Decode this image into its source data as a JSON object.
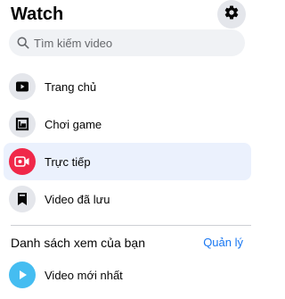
{
  "header": {
    "title": "Watch",
    "settings_icon": "gear-icon"
  },
  "search": {
    "placeholder": "Tìm kiếm video",
    "value": ""
  },
  "menu": {
    "items": [
      {
        "label": "Trang chủ",
        "icon": "play-icon",
        "active": false
      },
      {
        "label": "Chơi game",
        "icon": "gaming-icon",
        "active": false
      },
      {
        "label": "Trực tiếp",
        "icon": "live-camera-icon",
        "active": true
      },
      {
        "label": "Video đã lưu",
        "icon": "bookmark-icon",
        "active": false
      }
    ]
  },
  "watchlist": {
    "title": "Danh sách xem của bạn",
    "manage_label": "Quản lý",
    "items": [
      {
        "label": "Video mới nhất",
        "icon": "play-icon"
      }
    ]
  },
  "colors": {
    "accent": "#1877f2",
    "live": "#f02849",
    "active_bg": "#ebf1fd",
    "latest_icon": "#45bdf1"
  }
}
